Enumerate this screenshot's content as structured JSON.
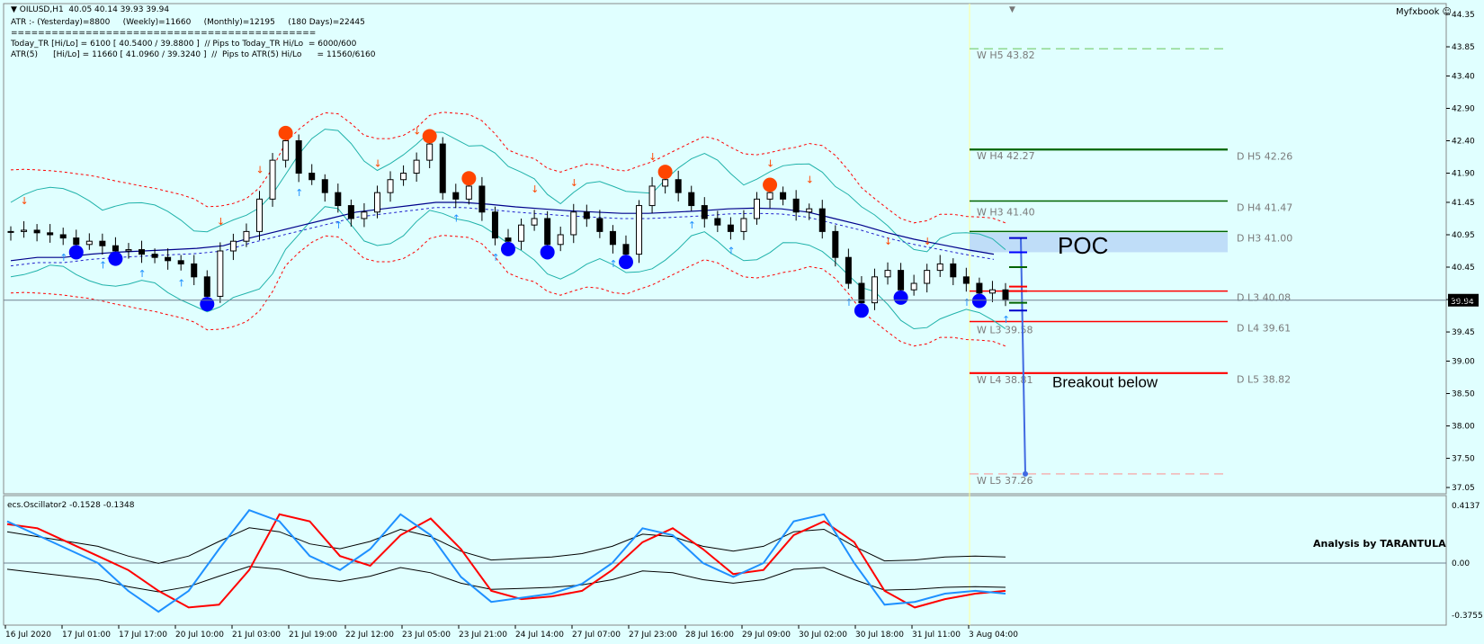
{
  "header": {
    "symbol_line": "OILUSD,H1  40.05 40.14 39.93 39.94",
    "atr_line": "ATR :- (Yesterday)=8800     (Weekly)=11660     (Monthly)=12195     (180 Days)=22445",
    "separator_line": "=============================================",
    "today_line": "Today_TR [Hi/Lo] = 6100 [ 40.5400 / 39.8800 ]  // Pips to Today_TR Hi/Lo  = 6000/600",
    "atr5_line": "ATR(5)      [Hi/Lo] = 11660 [ 41.0960 / 39.3240 ]  //  Pips to ATR(5) Hi/Lo      = 11560/6160",
    "brand": "Myfxbook"
  },
  "colors": {
    "background": "#E0FFFF",
    "resistance": "#006400",
    "support": "#FF0000",
    "bollinger": "#20B2AA",
    "envelope": "#FF0000",
    "ma": "#00008B",
    "osc_fast": "#1E90FF",
    "osc_slow": "#FF0000",
    "poc_zone": "#BFDDF8",
    "sell_dot": "#FF4500",
    "buy_dot": "#0000FF"
  },
  "annotations": {
    "poc": "POC",
    "breakout": "Breakout below",
    "analysis": "Analysis by TARANTULA",
    "osc_title": "ecs.Oscillator2 -0.1528 -0.1348",
    "current_price": "39.94"
  },
  "chart_data": [
    {
      "type": "line",
      "title": "OILUSD,H1",
      "ylim": [
        37.05,
        44.35
      ],
      "yticks": [
        "44.35",
        "43.85",
        "43.40",
        "42.90",
        "42.40",
        "41.90",
        "41.45",
        "40.95",
        "40.45",
        "39.95",
        "39.45",
        "39.00",
        "38.50",
        "38.00",
        "37.50",
        "37.05"
      ],
      "xticks": [
        "16 Jul 2020",
        "17 Jul 01:00",
        "17 Jul 17:00",
        "20 Jul 10:00",
        "21 Jul 03:00",
        "21 Jul 19:00",
        "22 Jul 12:00",
        "23 Jul 05:00",
        "23 Jul 21:00",
        "24 Jul 14:00",
        "27 Jul 07:00",
        "27 Jul 23:00",
        "28 Jul 16:00",
        "29 Jul 09:00",
        "30 Jul 02:00",
        "30 Jul 18:00",
        "31 Jul 11:00",
        "3 Aug 04:00"
      ],
      "series": [
        {
          "values": [
            41.0,
            41.02,
            40.98,
            40.95,
            40.9,
            40.8,
            40.85,
            40.78,
            40.7,
            40.72,
            40.65,
            40.6,
            40.55,
            40.5,
            40.3,
            40.0,
            40.7,
            40.85,
            41.0,
            41.5,
            42.1,
            42.4,
            41.9,
            41.8,
            41.6,
            41.4,
            41.2,
            41.3,
            41.6,
            41.8,
            41.9,
            42.1,
            42.35,
            41.6,
            41.5,
            41.7,
            41.3,
            40.9,
            40.85,
            41.1,
            41.2,
            40.8,
            40.95,
            41.3,
            41.2,
            41.0,
            40.8,
            40.65,
            41.4,
            41.7,
            41.8,
            41.6,
            41.4,
            41.2,
            41.1,
            41.0,
            41.2,
            41.5,
            41.6,
            41.5,
            41.3,
            41.35,
            41.0,
            40.6,
            40.2,
            39.9,
            40.3,
            40.4,
            40.1,
            40.2,
            40.4,
            40.5,
            40.3,
            40.2,
            40.05,
            40.1,
            39.94
          ]
        },
        {
          "values": [
            40.55,
            40.6,
            40.6,
            40.65,
            40.68,
            40.7,
            40.72,
            40.74,
            40.78,
            40.9,
            41.0,
            41.1,
            41.2,
            41.3,
            41.35,
            41.4,
            41.45,
            41.45,
            41.42,
            41.38,
            41.35,
            41.32,
            41.3,
            41.28,
            41.28,
            41.3,
            41.32,
            41.35,
            41.36,
            41.35,
            41.3,
            41.2,
            41.1,
            40.98,
            40.88,
            40.8,
            40.72,
            40.65
          ]
        }
      ],
      "levels": [
        {
          "label": "W  H5 43.82",
          "value": 43.82
        },
        {
          "label": "W  H4 42.27",
          "value": 42.27
        },
        {
          "label": "D  H5 42.26",
          "value": 42.26
        },
        {
          "label": "D  H4 41.47",
          "value": 41.47
        },
        {
          "label": "W  H3 41.40",
          "value": 41.4
        },
        {
          "label": "D  H3 41.00",
          "value": 41.0
        },
        {
          "label": "D  L3 40.08",
          "value": 40.08
        },
        {
          "label": "W  L3 39.58",
          "value": 39.58
        },
        {
          "label": "D  L4 39.61",
          "value": 39.61
        },
        {
          "label": "W  L4 38.81",
          "value": 38.81
        },
        {
          "label": "D  L5 38.82",
          "value": 38.82
        },
        {
          "label": "W  L5 37.26",
          "value": 37.26
        }
      ]
    },
    {
      "type": "line",
      "title": "ecs.Oscillator2 -0.1528 -0.1348",
      "ylim": [
        -0.3755,
        0.4137
      ],
      "yticks": [
        "0.4137",
        "0.00",
        "-0.3755"
      ],
      "series": [
        {
          "values": [
            0.3,
            0.2,
            0.1,
            0.0,
            -0.2,
            -0.35,
            -0.2,
            0.1,
            0.38,
            0.3,
            0.05,
            -0.05,
            0.1,
            0.35,
            0.2,
            -0.1,
            -0.28,
            -0.25,
            -0.22,
            -0.15,
            0.0,
            0.25,
            0.2,
            0.0,
            -0.1,
            0.0,
            0.3,
            0.35,
            0.0,
            -0.3,
            -0.28,
            -0.22,
            -0.2,
            -0.22
          ]
        },
        {
          "values": [
            0.28,
            0.25,
            0.15,
            0.05,
            -0.05,
            -0.2,
            -0.32,
            -0.3,
            -0.05,
            0.35,
            0.3,
            0.05,
            -0.02,
            0.2,
            0.32,
            0.1,
            -0.2,
            -0.26,
            -0.24,
            -0.2,
            -0.05,
            0.15,
            0.25,
            0.1,
            -0.08,
            -0.05,
            0.2,
            0.3,
            0.15,
            -0.2,
            -0.32,
            -0.26,
            -0.22,
            -0.2
          ]
        }
      ]
    }
  ]
}
